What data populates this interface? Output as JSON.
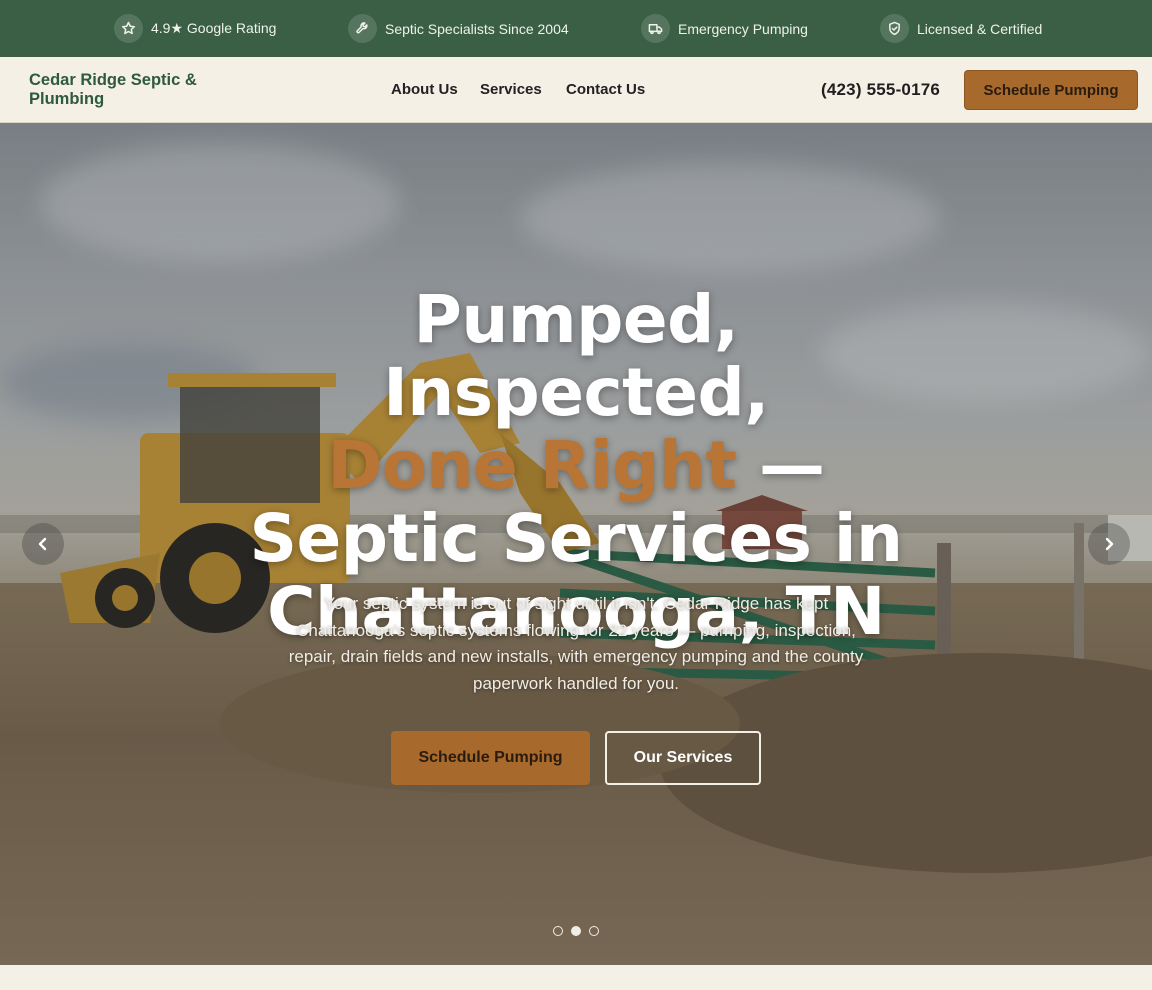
{
  "topbar": {
    "items": [
      {
        "icon": "star-icon",
        "label": "4.9★ Google Rating"
      },
      {
        "icon": "wrench-icon",
        "label": "Septic Specialists Since 2004"
      },
      {
        "icon": "truck-icon",
        "label": "Emergency Pumping"
      },
      {
        "icon": "shield-check-icon",
        "label": "Licensed & Certified"
      }
    ]
  },
  "header": {
    "logo": "Cedar Ridge Septic & Plumbing",
    "nav": [
      "About Us",
      "Services",
      "Contact Us"
    ],
    "phone": "(423) 555-0176",
    "cta": "Schedule Pumping"
  },
  "hero": {
    "title_line1": "Pumped, Inspected,",
    "title_accent": "Done Right",
    "title_rest": " — Septic Services in Chattanooga, TN",
    "subtitle": "Your septic system is out of sight until it isn't. Cedar Ridge has kept Chattanooga's septic systems flowing for 22 years — pumping, inspection, repair, drain fields and new installs, with emergency pumping and the county paperwork handled for you.",
    "primary_button": "Schedule Pumping",
    "secondary_button": "Our Services",
    "carousel_active_index": 1,
    "carousel_count": 3
  },
  "colors": {
    "brand_green": "#3a5f44",
    "accent": "#a8692d",
    "cream": "#f4f0e6"
  }
}
